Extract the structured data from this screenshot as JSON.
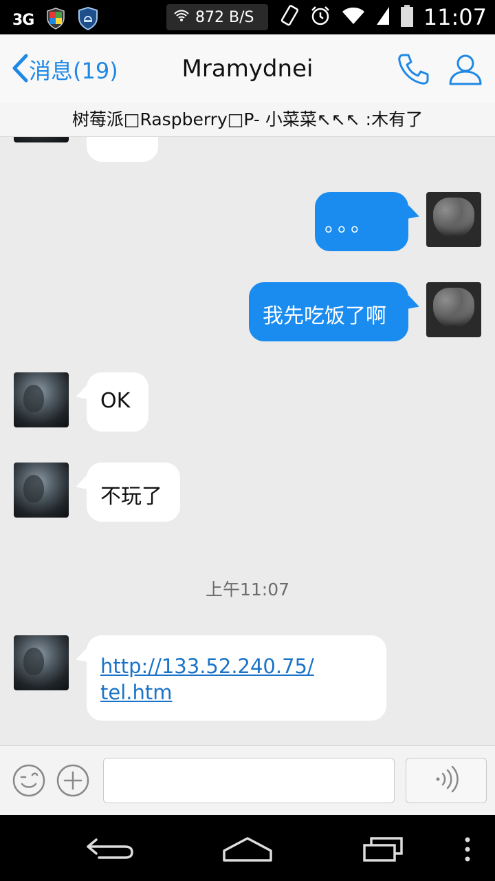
{
  "status_bar": {
    "network_type": "3G",
    "net_speed": "872 B/S",
    "time": "11:07",
    "icons": [
      "shield-color-icon",
      "shield-bell-icon",
      "wifi-icon",
      "rotate-icon",
      "alarm-icon",
      "wifi-signal-icon",
      "cell-signal-icon",
      "battery-icon"
    ]
  },
  "header": {
    "back_label": "消息(19)",
    "title": "Mramydnei",
    "accent": "#1e88e5"
  },
  "group_bar": {
    "text": "树莓派□Raspberry□P- 小菜菜↖↖↖  :木有了"
  },
  "messages": [
    {
      "side": "right",
      "text": "。。。"
    },
    {
      "side": "right",
      "text": "我先吃饭了啊"
    },
    {
      "side": "left",
      "text": "OK"
    },
    {
      "side": "left",
      "text": "不玩了"
    },
    {
      "side": "left",
      "link_line1": "http://133.52.240.75/",
      "link_line2": "tel.htm"
    }
  ],
  "timestamp": "上午11:07",
  "input_bar": {
    "placeholder": "",
    "icons": [
      "emoji-icon",
      "plus-icon",
      "voice-icon"
    ]
  },
  "colors": {
    "bubble_sent": "#1a8cf0",
    "bubble_received": "#ffffff",
    "chat_background": "#ebebeb",
    "link": "#1a73c8"
  }
}
